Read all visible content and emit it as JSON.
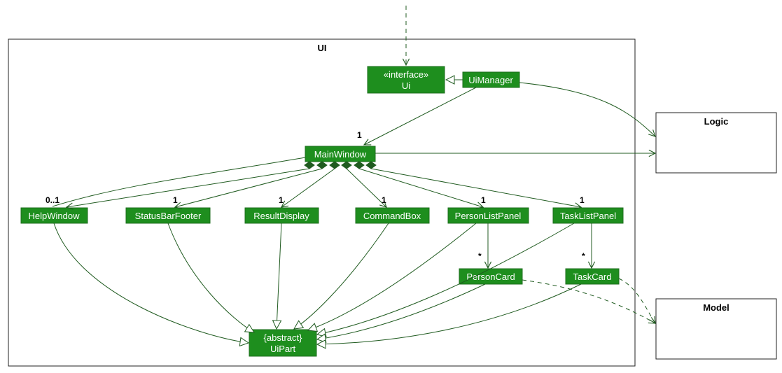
{
  "packages": {
    "ui": {
      "title": "UI"
    },
    "logic": {
      "title": "Logic"
    },
    "model": {
      "title": "Model"
    }
  },
  "nodes": {
    "ui_iface": {
      "stereotype": "«interface»",
      "name": "Ui"
    },
    "uimanager": {
      "name": "UiManager"
    },
    "mainwindow": {
      "name": "MainWindow"
    },
    "helpwindow": {
      "name": "HelpWindow"
    },
    "statusbar": {
      "name": "StatusBarFooter"
    },
    "resultdisp": {
      "name": "ResultDisplay"
    },
    "commandbox": {
      "name": "CommandBox"
    },
    "personlist": {
      "name": "PersonListPanel"
    },
    "tasklist": {
      "name": "TaskListPanel"
    },
    "personcard": {
      "name": "PersonCard"
    },
    "taskcard": {
      "name": "TaskCard"
    },
    "uipart": {
      "stereotype": "{abstract}",
      "name": "UiPart"
    }
  },
  "mult": {
    "mw": "1",
    "help": "0..1",
    "status": "1",
    "result": "1",
    "cmd": "1",
    "plist": "1",
    "tlist": "1",
    "pcard": "*",
    "tcard": "*"
  }
}
